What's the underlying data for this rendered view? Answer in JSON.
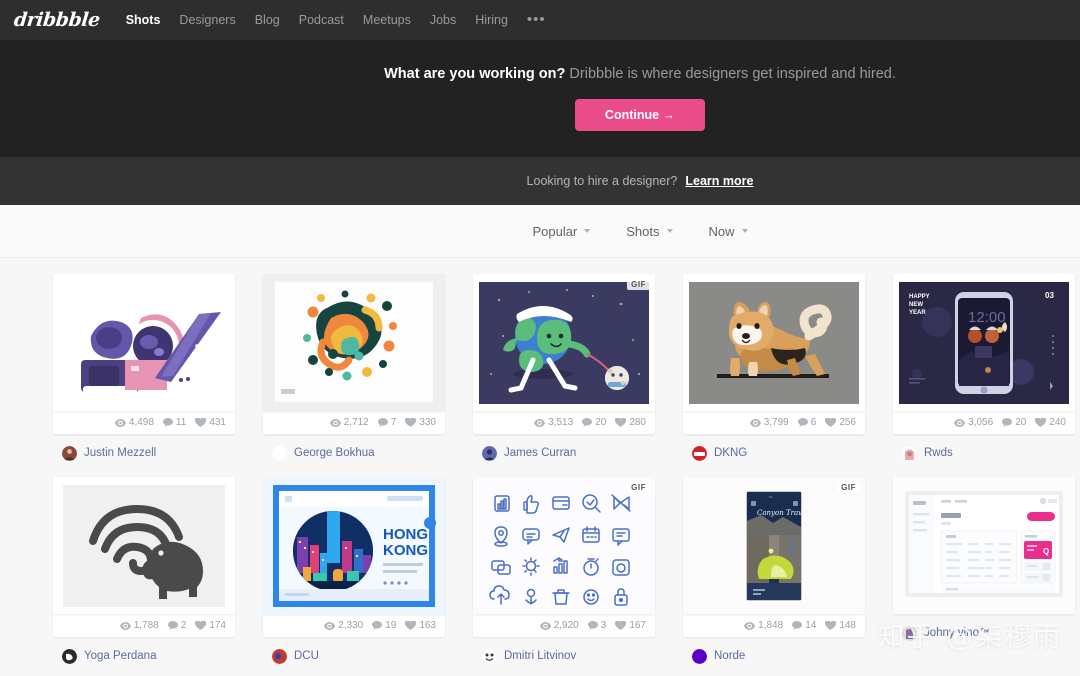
{
  "nav": {
    "logo": "dribbble",
    "items": [
      {
        "label": "Shots",
        "active": true
      },
      {
        "label": "Designers",
        "active": false
      },
      {
        "label": "Blog",
        "active": false
      },
      {
        "label": "Podcast",
        "active": false
      },
      {
        "label": "Meetups",
        "active": false
      },
      {
        "label": "Jobs",
        "active": false
      },
      {
        "label": "Hiring",
        "active": false
      }
    ],
    "more": "•••"
  },
  "hero": {
    "headline_bold": "What are you working on?",
    "headline_rest": " Dribbble is where designers get inspired and hired.",
    "cta": "Continue →",
    "cta_color": "#ea4c89",
    "bg_color": "#222222"
  },
  "hirebar": {
    "text": "Looking to hire a designer?",
    "link": "Learn more",
    "bg_color": "#333333"
  },
  "filters": [
    {
      "label": "Popular",
      "name": "sort-filter"
    },
    {
      "label": "Shots",
      "name": "type-filter"
    },
    {
      "label": "Now",
      "name": "time-filter"
    }
  ],
  "shots": [
    {
      "art": "camera-telescope",
      "views": "4,498",
      "comments": "11",
      "likes": "431",
      "author": "Justin Mezzell",
      "avatar_color": "#8a4a3a",
      "gif": false
    },
    {
      "art": "abstract-blobs",
      "views": "2,712",
      "comments": "7",
      "likes": "330",
      "author": "George Bokhua",
      "avatar_color": "#ffffff",
      "gif": false
    },
    {
      "art": "earth-walking-moon",
      "views": "3,513",
      "comments": "20",
      "likes": "280",
      "author": "James Curran",
      "avatar_color": "#5b6ab0",
      "gif": true
    },
    {
      "art": "shiba-inu-dog",
      "views": "3,799",
      "comments": "6",
      "likes": "256",
      "author": "DKNG",
      "avatar_color": "#d0202a",
      "gif": false
    },
    {
      "art": "happy-new-year-phone",
      "views": "3,056",
      "comments": "20",
      "likes": "240",
      "author": "Rwds",
      "avatar_color": "#e7a9a9",
      "gif": false
    },
    {
      "art": "wifi-elephant",
      "views": "1,788",
      "comments": "2",
      "likes": "174",
      "author": "Yoga Perdana",
      "avatar_color": "#2b2b2b",
      "gif": false
    },
    {
      "art": "hong-kong-city",
      "views": "2,330",
      "comments": "19",
      "likes": "163",
      "author": "DCU",
      "avatar_color": "#c13a3a",
      "gif": false
    },
    {
      "art": "blue-icon-set",
      "views": "2,920",
      "comments": "3",
      "likes": "167",
      "author": "Dmitri Litvinov",
      "avatar_color": "#ffffff",
      "gif": true
    },
    {
      "art": "canyon-travel-app",
      "views": "1,848",
      "comments": "14",
      "likes": "148",
      "author": "Norde",
      "avatar_color": "#5b00c8",
      "gif": true
    },
    {
      "art": "pink-dashboard-ui",
      "views": "",
      "comments": "",
      "likes": "",
      "author": "Johny vino™",
      "avatar_color": "#8d6aa0",
      "gif": false
    }
  ],
  "watermark": "知乎 @柒穆雨",
  "art_labels": {
    "happy_new_year": "HAPPY NEW YEAR",
    "happy_new_year_num": "03",
    "phone_time": "12:00",
    "hong_kong_line1": "HONG",
    "hong_kong_line2": "KONG",
    "gif_badge": "GIF"
  }
}
